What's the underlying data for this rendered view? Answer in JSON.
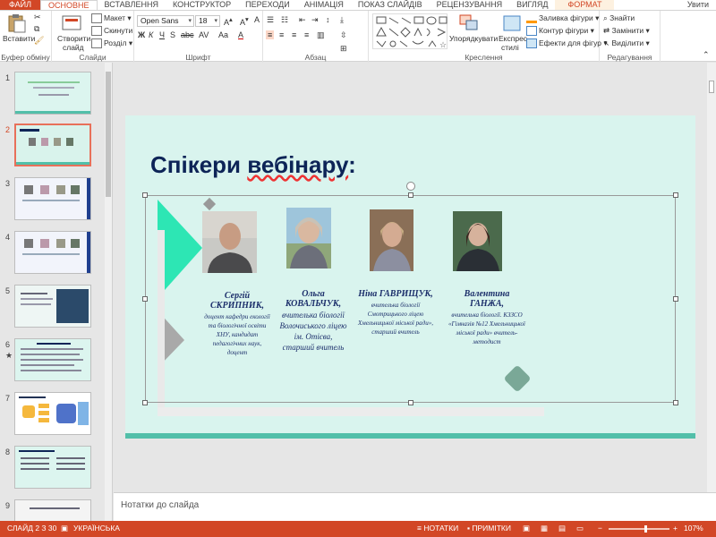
{
  "tabs": [
    "ФАЙЛ",
    "ОСНОВНЕ",
    "ВСТАВЛЕННЯ",
    "КОНСТРУКТОР",
    "ПЕРЕХОДИ",
    "АНІМАЦІЯ",
    "ПОКАЗ СЛАЙДІВ",
    "РЕЦЕНЗУВАННЯ",
    "ВИГЛЯД",
    "ФОРМАТ",
    "Увити"
  ],
  "ribbon": {
    "clipboard": {
      "paste": "Вставити",
      "label": "Буфер обміну"
    },
    "slides": {
      "new_slide": "Створити",
      "new_slide2": "слайд",
      "layout": "Макет",
      "reset": "Скинути",
      "section": "Розділ",
      "label": "Слайди"
    },
    "font": {
      "name": "Open Sans",
      "size": "18",
      "label": "Шрифт"
    },
    "paragraph": {
      "label": "Абзац"
    },
    "drawing": {
      "arrange": "Упорядкувати",
      "styles": "Експрес-",
      "styles2": "стилі",
      "fill": "Заливка фігури",
      "outline": "Контур фігури",
      "effects": "Ефекти для фігур",
      "label": "Креслення"
    },
    "editing": {
      "find": "Знайти",
      "replace": "Замінити",
      "select": "Виділити",
      "label": "Редагування"
    }
  },
  "thumbnails": [
    "1",
    "2",
    "3",
    "4",
    "5",
    "6",
    "7",
    "8",
    "9"
  ],
  "slide": {
    "title_a": "Спікери ",
    "title_b": "вебінару",
    "title_c": ":",
    "speakers": [
      {
        "name": "Сергій СКРИПНИК,",
        "desc": "доцент кафедри екології та біологічної освіти ХНУ, кандидат педагогічних наук, доцент"
      },
      {
        "name": "Ольга КОВАЛЬЧУК,",
        "desc": "вчителька біології Волочиського ліцею ім. Отієва, старший вчитель"
      },
      {
        "name": "Ніна ГАВРИЩУК,",
        "desc": "вчителька біології Смотрицького ліцею Хмельницької міської ради», старший вчитель"
      },
      {
        "name": "Валентина ГАНЖА,",
        "desc": "вчителька біології. КЗЗСО «Гімназія №12 Хмельницької міської ради» вчитель-методист"
      }
    ]
  },
  "notes_placeholder": "Нотатки до слайда",
  "status": {
    "slide": "СЛАЙД 2 З 30",
    "lang": "УКРАЇНСЬКА",
    "notes": "НОТАТКИ",
    "comments": "ПРИМІТКИ",
    "zoom": "107%"
  }
}
